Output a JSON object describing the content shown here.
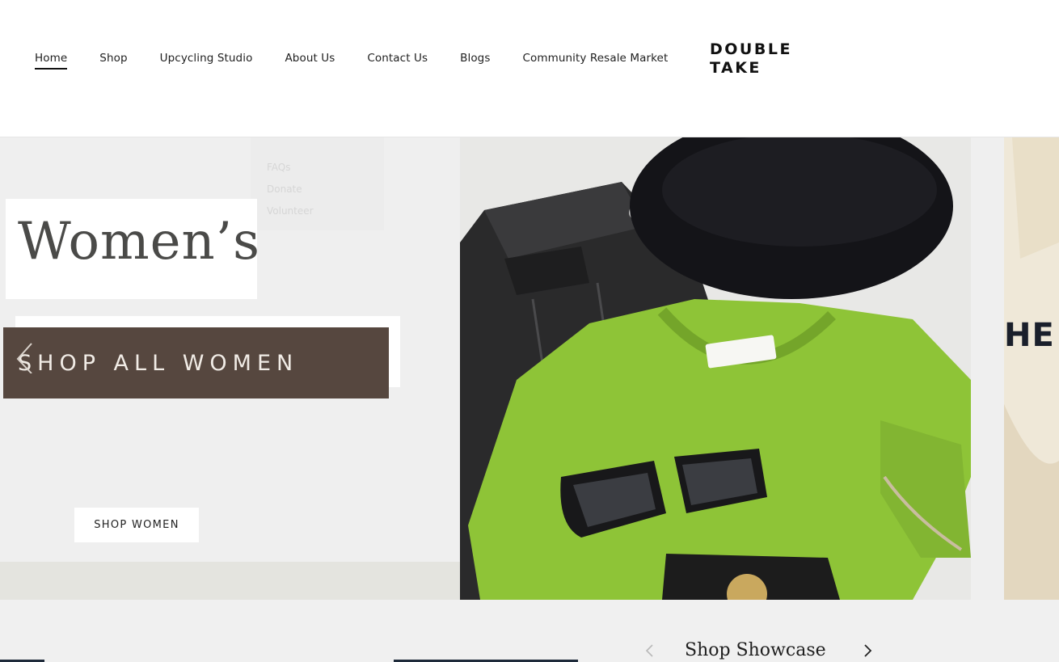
{
  "header": {
    "nav": [
      {
        "label": "Home",
        "active": true
      },
      {
        "label": "Shop",
        "active": false
      },
      {
        "label": "Upcycling Studio",
        "active": false
      },
      {
        "label": "About Us",
        "active": false
      },
      {
        "label": "Contact Us",
        "active": false
      },
      {
        "label": "Blogs",
        "active": false
      },
      {
        "label": "Community Resale Market",
        "active": false
      }
    ],
    "logo_line1": "DOUBLE",
    "logo_line2": "TAKE"
  },
  "dropdown_ghost": [
    "FAQs",
    "Donate",
    "Volunteer"
  ],
  "hero": {
    "title": "Women’s",
    "banner_text": "SHOP ALL WOMEN",
    "button_label": "SHOP WOMEN",
    "prev_icon": "chevron-left-icon",
    "banner_color": "#56473f",
    "sliver_text": "HE"
  },
  "showcase": {
    "title": "Shop Showcase",
    "prev_icon": "chevron-left-icon",
    "next_icon": "chevron-right-icon"
  }
}
